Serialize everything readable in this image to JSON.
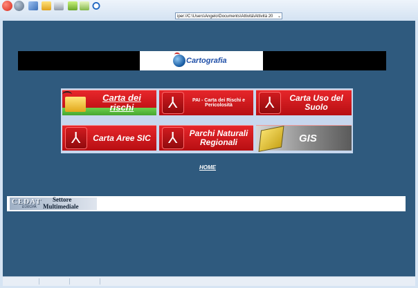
{
  "browser": {
    "address": "iper://C:\\Users\\Angelo\\Documents\\Attività\\Attività 20",
    "dropdown_glyph": "⌄",
    "toolbar_icons": [
      "back-icon",
      "forward-icon",
      "edit-icon",
      "folder-open-icon",
      "print-icon",
      "book-icon",
      "open-book-icon",
      "search-icon"
    ]
  },
  "banner": {
    "title": "Cartografia"
  },
  "menu": {
    "tiles": [
      {
        "label": "Carta dei rischi"
      },
      {
        "label": "PAI - Carta dei Rischi e Pericolosità"
      },
      {
        "label": "Carta Uso del Suolo"
      },
      {
        "label": "Carta Aree SIC"
      },
      {
        "label": "Parchi Naturali Regionali"
      },
      {
        "label": "GIS"
      }
    ]
  },
  "home_link": "HOME",
  "footer": {
    "logo_main": "CEDAT",
    "logo_sub": "EUROPA",
    "logo_settore": "Settore",
    "logo_multimediale": "Multimediale"
  },
  "colors": {
    "page_bg": "#2f5a7e",
    "banner_bg": "#000000",
    "tile_red": "#d71a1e",
    "home_link": "#ffffff"
  }
}
